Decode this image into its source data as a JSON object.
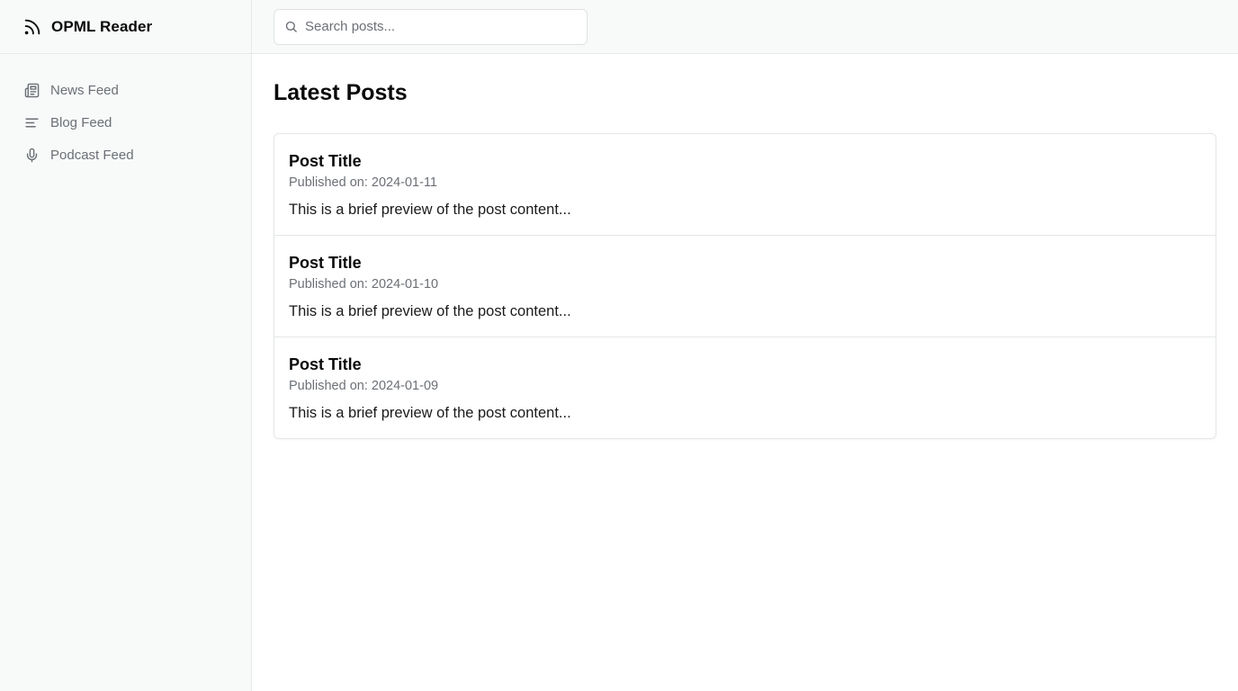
{
  "app": {
    "title": "OPML Reader",
    "brand_icon": "rss-icon"
  },
  "sidebar": {
    "items": [
      {
        "label": "News Feed",
        "icon": "newspaper-icon"
      },
      {
        "label": "Blog Feed",
        "icon": "lines-icon"
      },
      {
        "label": "Podcast Feed",
        "icon": "microphone-icon"
      }
    ]
  },
  "search": {
    "placeholder": "Search posts...",
    "value": "",
    "icon": "search-icon"
  },
  "main": {
    "title": "Latest Posts",
    "posts": [
      {
        "title": "Post Title",
        "date": "Published on: 2024-01-11",
        "preview": "This is a brief preview of the post content..."
      },
      {
        "title": "Post Title",
        "date": "Published on: 2024-01-10",
        "preview": "This is a brief preview of the post content..."
      },
      {
        "title": "Post Title",
        "date": "Published on: 2024-01-09",
        "preview": "This is a brief preview of the post content..."
      }
    ]
  },
  "colors": {
    "sidebar_bg": "#f8f9f9",
    "border": "#e6e8ea",
    "muted_text": "#6b7076",
    "primary_text": "#0a0a0a"
  }
}
